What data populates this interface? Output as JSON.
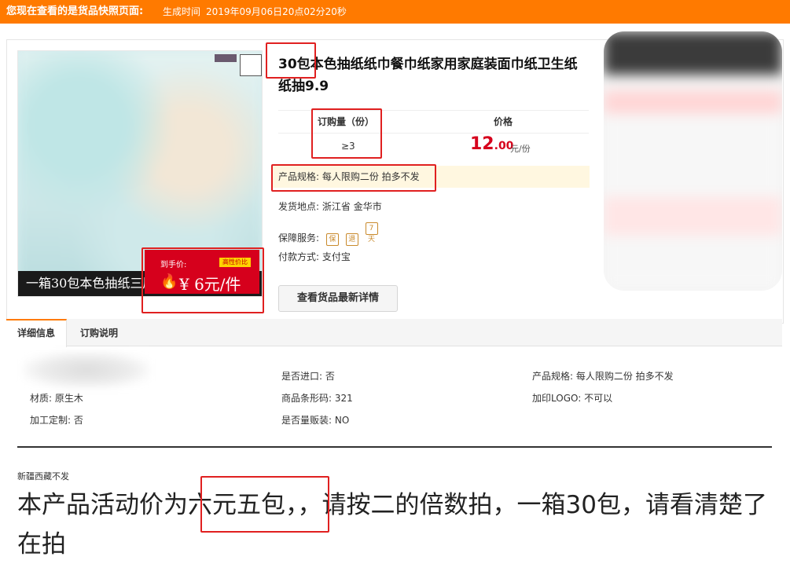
{
  "topbar": {
    "notice": "您现在查看的是货品快照页面:",
    "generated_label": "生成时间",
    "generated_time": "2019年09月06日20点02分20秒"
  },
  "product": {
    "title": "30包本色抽纸纸巾餐巾纸家用家庭装面巾纸卫生纸纸抽9.9",
    "image_caption": "一箱30包本色抽纸三层",
    "promo_label": "到手价:",
    "promo_badge": "高性价比",
    "promo_value": "¥ 6元/件",
    "order_qty_header": "订购量（份）",
    "price_header": "价格",
    "order_qty": "≥3",
    "price_int": "12",
    "price_dec": ".00",
    "price_unit": "元/份",
    "spec": "产品规格: 每人限购二份 拍多不发",
    "ship_label": "发货地点:",
    "ship_value": "浙江省 金华市",
    "guarantee_label": "保障服务:",
    "guarantee_icons": [
      "保",
      "退",
      "7天"
    ],
    "payment_label": "付款方式:",
    "payment_value": "支付宝",
    "view_latest_button": "查看货品最新详情"
  },
  "tabs": [
    {
      "label": "详细信息"
    },
    {
      "label": "订购说明"
    }
  ],
  "details": {
    "material": "材质: 原生木",
    "custom": "加工定制: 否",
    "import": "是否进口: 否",
    "barcode": "商品条形码: 321",
    "bulk": "是否量贩装: NO",
    "spec": "产品规格: 每人限购二份 拍多不发",
    "logo": "加印LOGO: 不可以"
  },
  "description": {
    "note": "新疆西藏不发",
    "text": "本产品活动价为六元五包，，请按二的倍数拍，一箱30包，请看清楚了在拍"
  },
  "colors": {
    "topbar": "#ff7a00",
    "price": "#d6001c",
    "annotation": "#e02020"
  }
}
